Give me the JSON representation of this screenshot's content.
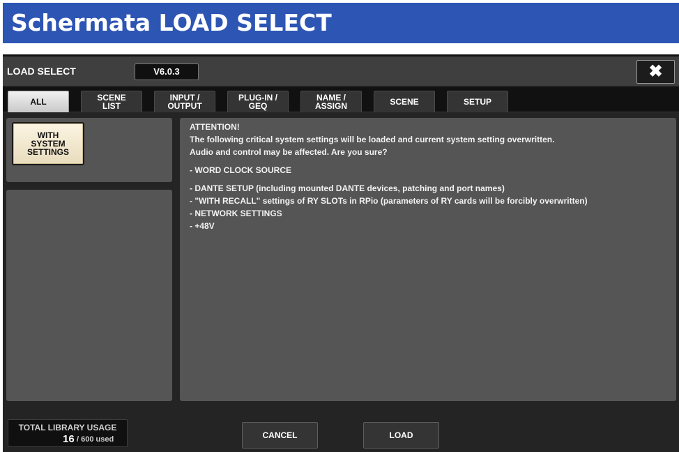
{
  "page_header": "Schermata LOAD SELECT",
  "window": {
    "title": "LOAD SELECT",
    "version": "V6.0.3",
    "close_glyph": "✖"
  },
  "tabs": [
    {
      "label": "ALL",
      "active": true
    },
    {
      "label": "SCENE\nLIST",
      "active": false
    },
    {
      "label": "INPUT /\nOUTPUT",
      "active": false
    },
    {
      "label": "PLUG-IN /\nGEQ",
      "active": false
    },
    {
      "label": "NAME /\nASSIGN",
      "active": false
    },
    {
      "label": "SCENE",
      "active": false
    },
    {
      "label": "SETUP",
      "active": false
    }
  ],
  "system_settings_button": "WITH\nSYSTEM\nSETTINGS",
  "message": {
    "heading": "ATTENTION!",
    "line1": "The following critical system settings will be loaded and current system setting overwritten.",
    "line2": "Audio and control may be affected. Are you sure?",
    "items": [
      "- WORD CLOCK SOURCE",
      "- DANTE SETUP (including mounted DANTE devices, patching and port names)",
      "- \"WITH RECALL\" settings of RY SLOTs in RPio (parameters of RY cards will be forcibly overwritten)",
      "- NETWORK SETTINGS",
      "- +48V"
    ]
  },
  "usage": {
    "label": "TOTAL LIBRARY USAGE",
    "count": "16",
    "total": "/ 600 used"
  },
  "buttons": {
    "cancel": "CANCEL",
    "load": "LOAD"
  },
  "colors": {
    "header_bg": "#2d55b3",
    "active_tab": "#e0e0e0",
    "system_button": "#f4ead0"
  }
}
